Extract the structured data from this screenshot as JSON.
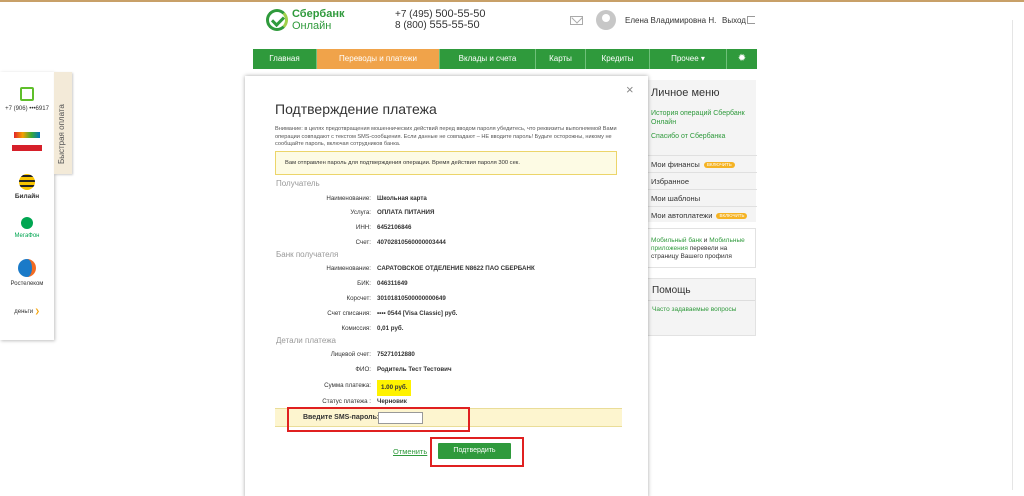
{
  "header": {
    "logo_line1": "Сбербанк",
    "logo_line2": "Онлайн",
    "phone1_prefix": "+7 (495) ",
    "phone1_number": "500-55-50",
    "phone2_prefix": "8 (800) ",
    "phone2_number": "555-55-50",
    "user_name": "Елена Владимировна Н.",
    "logout_label": "Выход"
  },
  "nav": {
    "items": [
      {
        "label": "Главная"
      },
      {
        "label": "Переводы и платежи"
      },
      {
        "label": "Вклады и счета"
      },
      {
        "label": "Карты"
      },
      {
        "label": "Кредиты"
      },
      {
        "label": "Прочее ▾"
      }
    ],
    "active_index": 1
  },
  "quickpay": {
    "tab_label": "Быстрая оплата",
    "phone_label": "+7 (906) •••6917",
    "beeline_label": "Билайн",
    "megafon_label": "МегаФон",
    "rostelecom_label": "Ростелеком",
    "yandex_label": "деньги"
  },
  "right_menu": {
    "title": "Личное меню",
    "link1": "История операций Сбербанк Онлайн",
    "link2": "Спасибо от Сбербанка",
    "row1": "Мои финансы",
    "row2": "Избранное",
    "row3": "Мои шаблоны",
    "row4": "Мои автоплатежи",
    "badge": "ВКЛЮЧИТЬ",
    "promo_link1": "Мобильный банк",
    "promo_and": " и ",
    "promo_link2": "Мобильные приложения",
    "promo_rest": " перевели на страницу Вашего профиля",
    "help_title": "Помощь",
    "help_link": "Часто задаваемые вопросы"
  },
  "modal": {
    "close": "×",
    "title": "Подтверждение платежа",
    "warning": "Внимание: в целях предотвращения мошеннических действий перед вводом пароля убедитесь, что реквизиты выполняемой Вами операции совпадают с текстом SMS-сообщения. Если данные не совпадают – НЕ вводите пароль! Будьте осторожны, никому не сообщайте пароль, включая сотрудников банка.",
    "sms_notice": "Вам отправлен пароль для подтверждения операции. Время действия пароля 300 сек.",
    "section_recipient": "Получатель",
    "section_bank": "Банк получателя",
    "section_details": "Детали платежа",
    "recipient": [
      {
        "label": "Наименование:",
        "value": "Школьная карта"
      },
      {
        "label": "Услуга:",
        "value": "ОПЛАТА ПИТАНИЯ"
      },
      {
        "label": "ИНН:",
        "value": "6452106846"
      },
      {
        "label": "Счет:",
        "value": "40702810560000003444"
      }
    ],
    "bank": [
      {
        "label": "Наименование:",
        "value": "САРАТОВСКОЕ ОТДЕЛЕНИЕ N8622 ПАО СБЕРБАНК"
      },
      {
        "label": "БИК:",
        "value": "046311649"
      },
      {
        "label": "Корсчет:",
        "value": "30101810500000000649"
      },
      {
        "label": "Счет списания:",
        "value": "•••• 0544  [Visa Classic]  руб."
      },
      {
        "label": "Комиссия:",
        "value": "0,01 руб."
      }
    ],
    "details": [
      {
        "label": "Лицевой счет:",
        "value": "75271012880"
      },
      {
        "label": "ФИО:",
        "value": "Родитель Тест Тестович"
      },
      {
        "label": "Сумма платежа:",
        "value": "1.00 руб."
      },
      {
        "label": "Статус платежа :",
        "value": "Черновик"
      }
    ],
    "sms_label": "Введите SMS-пароль:",
    "sms_value": "",
    "cancel_label": "Отменить",
    "confirm_label": "Подтвердить"
  }
}
